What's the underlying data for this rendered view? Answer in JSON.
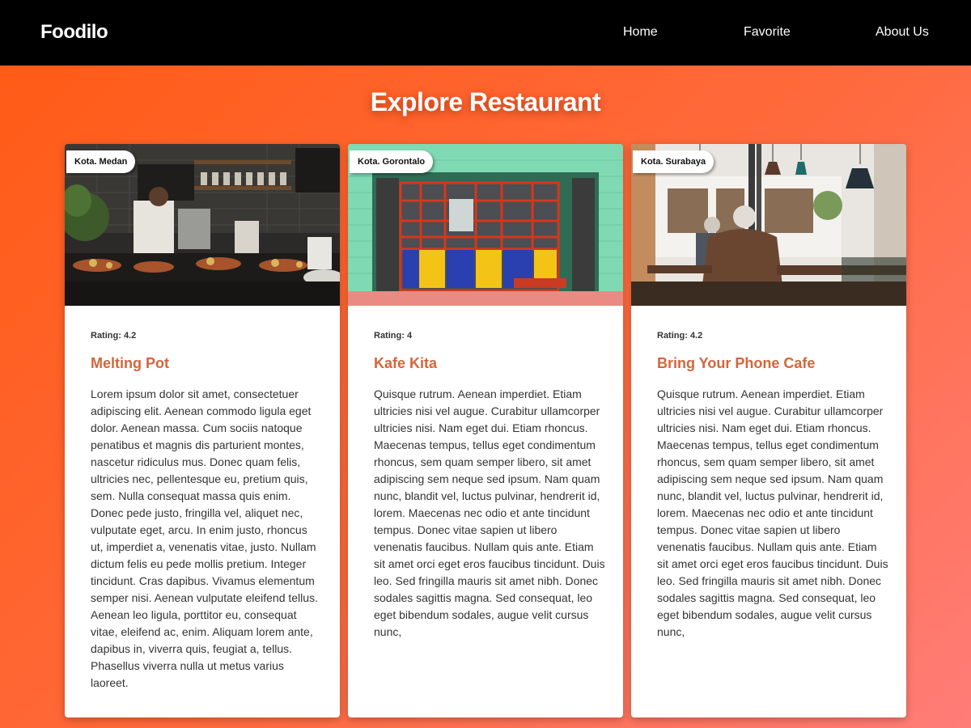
{
  "header": {
    "brand": "Foodilo",
    "nav": [
      {
        "label": "Home"
      },
      {
        "label": "Favorite"
      },
      {
        "label": "About Us"
      }
    ]
  },
  "main": {
    "title": "Explore Restaurant",
    "restaurants": [
      {
        "city": "Kota. Medan",
        "rating": "Rating: 4.2",
        "name": "Melting Pot",
        "description": "Lorem ipsum dolor sit amet, consectetuer adipiscing elit. Aenean commodo ligula eget dolor. Aenean massa. Cum sociis natoque penatibus et magnis dis parturient montes, nascetur ridiculus mus. Donec quam felis, ultricies nec, pellentesque eu, pretium quis, sem. Nulla consequat massa quis enim. Donec pede justo, fringilla vel, aliquet nec, vulputate eget, arcu. In enim justo, rhoncus ut, imperdiet a, venenatis vitae, justo. Nullam dictum felis eu pede mollis pretium. Integer tincidunt. Cras dapibus. Vivamus elementum semper nisi. Aenean vulputate eleifend tellus. Aenean leo ligula, porttitor eu, consequat vitae, eleifend ac, enim. Aliquam lorem ante, dapibus in, viverra quis, feugiat a, tellus. Phasellus viverra nulla ut metus varius laoreet."
      },
      {
        "city": "Kota. Gorontalo",
        "rating": "Rating: 4",
        "name": "Kafe Kita",
        "description": "Quisque rutrum. Aenean imperdiet. Etiam ultricies nisi vel augue. Curabitur ullamcorper ultricies nisi. Nam eget dui. Etiam rhoncus. Maecenas tempus, tellus eget condimentum rhoncus, sem quam semper libero, sit amet adipiscing sem neque sed ipsum. Nam quam nunc, blandit vel, luctus pulvinar, hendrerit id, lorem. Maecenas nec odio et ante tincidunt tempus. Donec vitae sapien ut libero venenatis faucibus. Nullam quis ante. Etiam sit amet orci eget eros faucibus tincidunt. Duis leo. Sed fringilla mauris sit amet nibh. Donec sodales sagittis magna. Sed consequat, leo eget bibendum sodales, augue velit cursus nunc,"
      },
      {
        "city": "Kota. Surabaya",
        "rating": "Rating: 4.2",
        "name": "Bring Your Phone Cafe",
        "description": "Quisque rutrum. Aenean imperdiet. Etiam ultricies nisi vel augue. Curabitur ullamcorper ultricies nisi. Nam eget dui. Etiam rhoncus. Maecenas tempus, tellus eget condimentum rhoncus, sem quam semper libero, sit amet adipiscing sem neque sed ipsum. Nam quam nunc, blandit vel, luctus pulvinar, hendrerit id, lorem. Maecenas nec odio et ante tincidunt tempus. Donec vitae sapien ut libero venenatis faucibus. Nullam quis ante. Etiam sit amet orci eget eros faucibus tincidunt. Duis leo. Sed fringilla mauris sit amet nibh. Donec sodales sagittis magna. Sed consequat, leo eget bibendum sodales, augue velit cursus nunc,"
      }
    ]
  },
  "colors": {
    "navbar": "#000000",
    "card_title": "#d2663b",
    "background_start": "#ff5a14",
    "background_end": "#ff7d78"
  }
}
